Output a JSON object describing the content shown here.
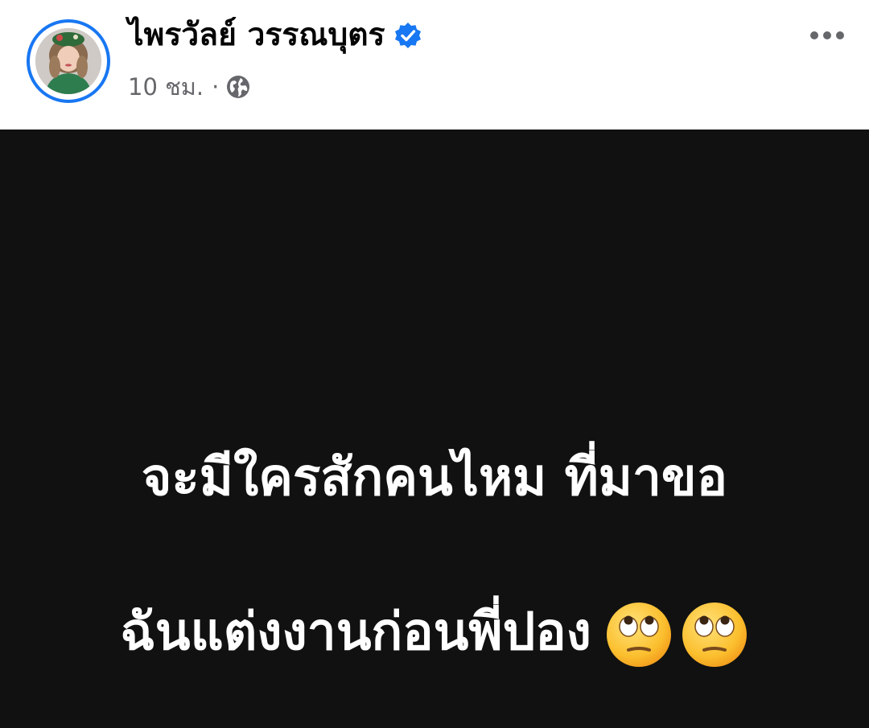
{
  "post": {
    "author": "ไพรวัลย์ วรรณบุตร",
    "verified": true,
    "timestamp": "10 ชม.",
    "separator": "·",
    "audience_icon": "globe-icon",
    "more_icon": "more-horizontal-icon"
  },
  "card": {
    "line1": "จะมีใครสักคนไหม ที่มาขอ",
    "line2": "ฉันแต่งงานก่อนพี่ปอง",
    "emojis": [
      "face-with-rolling-eyes",
      "face-with-rolling-eyes"
    ],
    "background": "#111111",
    "text_color": "#ffffff"
  },
  "colors": {
    "accent": "#1877f2",
    "secondary_text": "#65676b"
  }
}
